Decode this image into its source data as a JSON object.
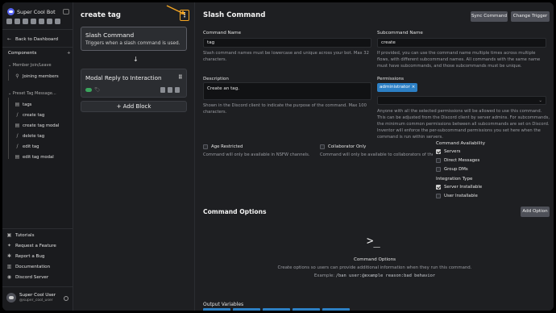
{
  "sidebar": {
    "bot_name": "Super Cool Bot",
    "back": "Back to Dashboard",
    "components": "Components",
    "groups": [
      {
        "name": "Member Join/Leave",
        "items": [
          "Joining members"
        ]
      },
      {
        "name": "Preset Tag Message...",
        "items": [
          "tags",
          "create tag",
          "create tag modal",
          "delete tag",
          "edit tag",
          "edit tag modal"
        ]
      }
    ],
    "links": [
      "Tutorials",
      "Request a Feature",
      "Report a Bug",
      "Documentation",
      "Discord Server"
    ],
    "user": {
      "name": "Super Cool User",
      "handle": "@super_cool_user"
    }
  },
  "middle": {
    "title": "create tag",
    "menu_glyph": "⋮",
    "card1": {
      "title": "Slash Command",
      "desc": "Triggers when a slash command is used."
    },
    "arrow": "↓",
    "card2": {
      "title": "Modal Reply to Interaction",
      "tag_glyph": "🏷"
    },
    "add_block": "+ Add Block"
  },
  "right": {
    "title": "Slash Command",
    "sync_btn": "Sync Command",
    "change_btn": "Change Trigger",
    "cmd_name_label": "Command Name",
    "cmd_name_value": "tag",
    "cmd_name_help": "Slash command names must be lowercase and unique across your bot. Max 32 characters.",
    "sub_label": "Subcommand Name",
    "sub_value": "create",
    "sub_help": "If provided, you can use the command name multiple times across multiple flows, with different subcommand names. All commands with the same name must have subcommands, and those subcommands must be unique.",
    "desc_label": "Description",
    "desc_value": "Create an tag.",
    "desc_help": "Shown in the Discord client to indicate the purpose of the command. Max 100 characters.",
    "perm_label": "Permissions",
    "perm_chip": "administrator ×",
    "perm_help": "Anyone with all the selected permissions will be allowed to use this command. This can be adjusted from the Discord client by server admins. For subcommands, the minimum common permissions between all subcommands are set on Discord. Inventor will enforce the per-subcommand permissions you set here when the command is run within servers.",
    "age": {
      "label": "Age Restricted",
      "help": "Command will only be available in NSFW channels."
    },
    "collab": {
      "label": "Collaborator Only",
      "help": "Command will only be available to collaborators of the bot."
    },
    "availability": {
      "title": "Command Availability",
      "opts": [
        {
          "label": "Servers",
          "on": true
        },
        {
          "label": "Direct Messages",
          "on": false
        },
        {
          "label": "Group DMs",
          "on": false
        }
      ]
    },
    "integration": {
      "title": "Integration Type",
      "opts": [
        {
          "label": "Server Installable",
          "on": true
        },
        {
          "label": "User Installable",
          "on": false
        }
      ]
    },
    "options_title": "Command Options",
    "add_option": "Add Option",
    "term_glyph": ">_",
    "co_title": "Command Options",
    "co_desc": "Create options so users can provide additional information when they run this command.",
    "co_ex_prefix": "Example:",
    "co_ex_code": "/ban user:@example reason:bad behavior",
    "output_vars": "Output Variables"
  },
  "colors": {
    "accent": "#f5a623",
    "chip": "#2c7fc4",
    "toggle": "#3ba55d"
  }
}
